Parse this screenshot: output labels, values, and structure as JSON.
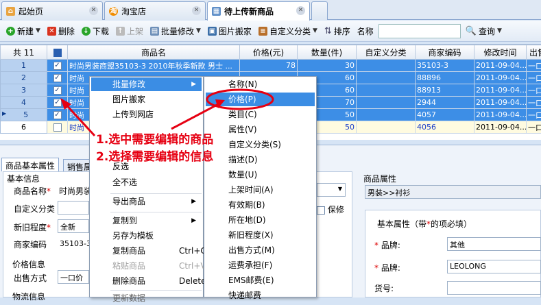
{
  "tabs": [
    {
      "label": "起始页"
    },
    {
      "label": "淘宝店"
    },
    {
      "label": "待上传新商品"
    }
  ],
  "toolbar": {
    "new": "新建",
    "delete": "删除",
    "download": "下载",
    "shelve": "上架",
    "batch_edit": "批量修改",
    "image_move": "图片搬家",
    "custom_cat": "自定义分类",
    "sort": "排序",
    "name_label": "名称",
    "search": "查询",
    "name_value": ""
  },
  "grid": {
    "headers": [
      "共 11",
      "",
      "商品名",
      "价格(元)",
      "数量(件)",
      "自定义分类",
      "商家编码",
      "修改时间",
      "出售"
    ],
    "rows": [
      {
        "n": "1",
        "name": "时尚男装商盟35103-3 2010年秋季新款 男士 ...",
        "price": "78",
        "qty": "30",
        "code": "35103-3",
        "time": "2011-09-04...",
        "sell": "一口价"
      },
      {
        "n": "2",
        "name": "时尚",
        "price": "",
        "qty": "60",
        "code": "88896",
        "time": "2011-09-04...",
        "sell": "一口价"
      },
      {
        "n": "3",
        "name": "时尚",
        "price": "",
        "qty": "60",
        "code": "88913",
        "time": "2011-09-04...",
        "sell": "一口价"
      },
      {
        "n": "4",
        "name": "时尚",
        "price": "",
        "qty": "70",
        "code": "2944",
        "time": "2011-09-04...",
        "sell": "一口价"
      },
      {
        "n": "5",
        "name": "时尚",
        "price": "",
        "qty": "50",
        "code": "4057",
        "time": "2011-09-04...",
        "sell": "一口价"
      },
      {
        "n": "6",
        "name": "时尚",
        "price": "",
        "qty": "50",
        "code": "4056",
        "time": "2011-09-04...",
        "sell": "一口价"
      }
    ]
  },
  "bottom": {
    "tabs": [
      "商品基本属性",
      "销售属"
    ],
    "basic": "基本信息",
    "name_label": "商品名称",
    "name_value": "时尚男装",
    "custom_label": "自定义分类",
    "condition_label": "新旧程度",
    "condition_value": "全新",
    "code_label": "商家编码",
    "code_value": "35103-3",
    "price_info": "价格信息",
    "sell_label": "出售方式",
    "sell_value": "一口价",
    "logistics": "物流信息",
    "keep": "保修",
    "attr_title": "商品属性",
    "attr_value": "男装>>衬衫",
    "attr_basic": "基本属性（带",
    "attr_basic2": "的项必填）",
    "brand_label": "品牌:",
    "brand_value": "其他",
    "brand2_label": "品牌:",
    "brand2_value": "LEOLONG",
    "item_no_label": "货号:"
  },
  "menu1": [
    "批量修改",
    "图片搬家",
    "上传到网店",
    "",
    "反选",
    "全不选",
    "导出商品",
    "复制到",
    "另存为模板",
    "复制商品",
    "粘贴商品",
    "删除商品",
    "更新数据"
  ],
  "menu1_sc": {
    "copy": "Ctrl+C",
    "paste": "Ctrl+V",
    "del": "Delete"
  },
  "menu2": [
    "名称(N)",
    "价格(P)",
    "类目(C)",
    "属性(V)",
    "自定义分类(S)",
    "描述(D)",
    "数量(U)",
    "上架时间(A)",
    "有效期(B)",
    "所在地(D)",
    "新旧程度(X)",
    "出售方式(M)",
    "运费承担(F)",
    "EMS邮费(E)",
    "快递邮费"
  ],
  "annotation": {
    "line1": "1.选中需要编辑的商品",
    "line2": "2.选择需要编辑的信息"
  },
  "colors": {
    "selection": "#3d8ee6",
    "annotation": "#e60012"
  }
}
